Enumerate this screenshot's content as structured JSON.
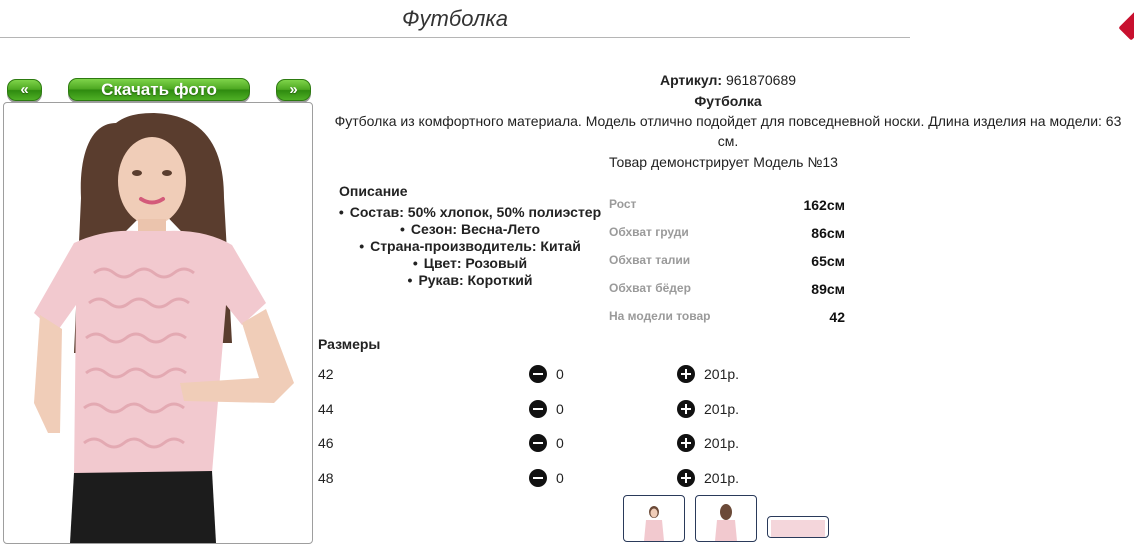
{
  "header": {
    "title": "Футболка"
  },
  "gallery": {
    "prev_label": "«",
    "download_label": "Скачать фото",
    "next_label": "»"
  },
  "product": {
    "article_label": "Артикул:",
    "article_value": "961870689",
    "name": "Футболка",
    "description_line1": "Футболка из комфортного материала. Модель отлично подойдет для повседневной носки. Длина изделия на модели: 63",
    "description_line2": "см.",
    "model_note": "Товар демонстрирует Модель №13"
  },
  "specs": {
    "title": "Описание",
    "items": [
      "Состав: 50% хлопок, 50% полиэстер",
      "Сезон: Весна-Лето",
      "Страна-производитель: Китай",
      "Цвет: Розовый",
      "Рукав: Короткий"
    ]
  },
  "measurements": [
    {
      "label": "Рост",
      "value": "162см"
    },
    {
      "label": "Обхват груди",
      "value": "86см"
    },
    {
      "label": "Обхват талии",
      "value": "65см"
    },
    {
      "label": "Обхват бёдер",
      "value": "89см"
    },
    {
      "label": "На модели товар",
      "value": "42"
    }
  ],
  "sizes": {
    "title": "Размеры",
    "rows": [
      {
        "size": "42",
        "qty": "0",
        "price": "201р."
      },
      {
        "size": "44",
        "qty": "0",
        "price": "201р."
      },
      {
        "size": "46",
        "qty": "0",
        "price": "201р."
      },
      {
        "size": "48",
        "qty": "0",
        "price": "201р."
      }
    ]
  },
  "colors": {
    "accent_green": "#4da821",
    "shirt_pink": "#f2c9cf",
    "close_red": "#c8102e"
  }
}
